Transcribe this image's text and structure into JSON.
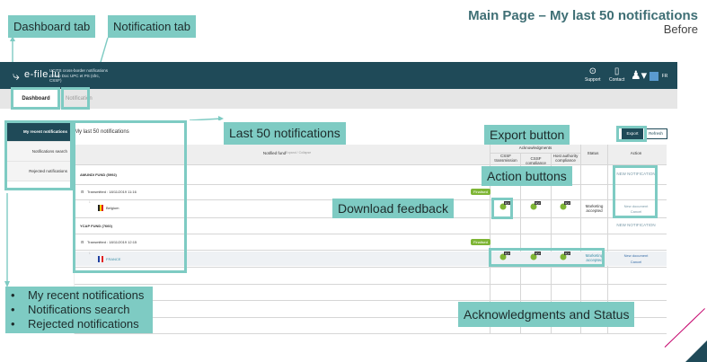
{
  "slide": {
    "title": "Main Page – My last 50 notifications",
    "subtitle": "Before"
  },
  "callouts": {
    "dashboard_tab": "Dashboard tab",
    "notification_tab": "Notification tab",
    "last_50": "Last 50 notifications",
    "export_button": "Export button",
    "action_buttons": "Action buttons",
    "download_feedback": "Download feedback",
    "acks_status": "Acknowledgments and Status",
    "sidebar_list": [
      "My recent notifications",
      "Notifications search",
      "Rejected notifications"
    ]
  },
  "app": {
    "brand": "e-file.lu",
    "brand_sub": "UCITS cross-border notifications Group Doc UPC et PS (sfrc, CSSF)",
    "support_label": "Support",
    "contact_label": "Contact",
    "lang_1": "",
    "lang_2": "FR"
  },
  "tabs": {
    "dashboard": "Dashboard",
    "notification": "Notification"
  },
  "sidebar": {
    "items": [
      "My recent notifications",
      "Notifications search",
      "Rejected notifications"
    ]
  },
  "page": {
    "heading": "My last 50 notifications",
    "export_label": "Export",
    "refresh_label": "Refresh"
  },
  "table": {
    "notified_fund_header": "Notified fund",
    "notified_fund_sub": "Expand / Collapse",
    "ack_header": "Acknowledgments",
    "ack_cols": [
      "CSSF transmission",
      "CSSF compliance",
      "Host authority compliance"
    ],
    "status_header": "Status",
    "action_header": "Action",
    "rows": [
      {
        "fund": "AMUNDI FUND (5992)",
        "transmitted": "Transmitted : 18/11/2019 11:16",
        "finalised_label": "Finalised",
        "country": "Belgium",
        "status": "Marketing accepted",
        "top_action": "NEW NOTIFICATION",
        "action_1": "New document",
        "action_2": "Cancel"
      },
      {
        "fund": "YCAP FUND (7660)",
        "transmitted": "Transmitted : 18/11/2019 12:15",
        "finalised_label": "Finalised",
        "country": "FRANCE",
        "status": "Marketing accepted",
        "top_action": "NEW NOTIFICATION",
        "action_1": "New document",
        "action_2": "Cancel"
      }
    ],
    "pdf_label": "PDF"
  },
  "colors": {
    "teal_brand": "#1f4a58",
    "callout_teal": "#7ecbc3",
    "finalised_green": "#7eb535",
    "title_teal": "#3f6f75"
  }
}
